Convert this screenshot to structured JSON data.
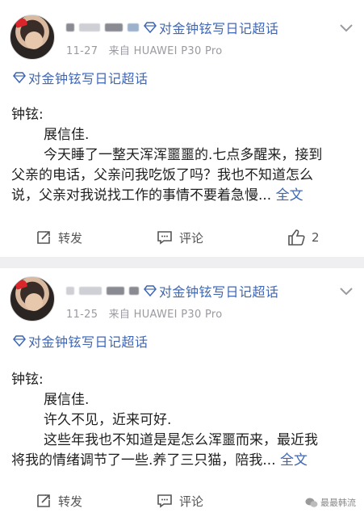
{
  "posts": [
    {
      "topic": "对金钟铉写日记超话",
      "time": "11-27",
      "source": "来自 HUAWEI P30 Pro",
      "topic_tag": "对金钟铉写日记超话",
      "greeting": "钟铉:",
      "lines": [
        "展信佳.",
        "今天睡了一整天浑浑噩噩的.七点多醒来，接到",
        "父亲的电话，父亲问我吃饭了吗？我也不知道怎么",
        "说，父亲对我说找工作的事情不要着急慢..."
      ],
      "more": "全文",
      "repost": "转发",
      "comment": "评论",
      "likes": "2"
    },
    {
      "topic": "对金钟铉写日记超话",
      "time": "11-25",
      "source": "来自 HUAWEI P30 Pro",
      "topic_tag": "对金钟铉写日记超话",
      "greeting": "钟铉:",
      "lines": [
        "展信佳.",
        "许久不见，近来可好.",
        "这些年我也不知道是是怎么浑噩而来，最近我",
        "将我的情绪调节了一些.养了三只猫，陪我..."
      ],
      "more": "全文",
      "repost": "转发",
      "comment": "评论"
    }
  ],
  "watermark": "最最韩流",
  "colors": {
    "link": "#3e66b4",
    "meta": "#9a9aa0",
    "bg": "#efeff2"
  },
  "icons": [
    "diamond-icon",
    "chevron-down-icon",
    "repost-icon",
    "comment-icon",
    "like-icon",
    "wechat-icon"
  ]
}
